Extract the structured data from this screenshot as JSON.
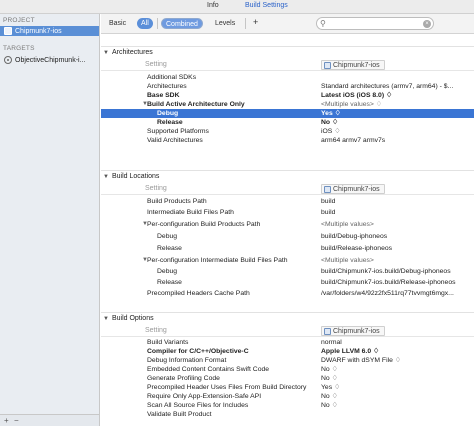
{
  "topbar": {
    "tab_info": "Info",
    "tab_build_settings": "Build Settings"
  },
  "sidebar": {
    "project_header": "PROJECT",
    "project_item": "Chipmunk7-ios",
    "targets_header": "TARGETS",
    "target_item": "ObjectiveChipmunk-i...",
    "add_label": "+",
    "remove_label": "−"
  },
  "filterbar": {
    "basic": "Basic",
    "all": "All",
    "combined": "Combined",
    "levels": "Levels",
    "add": "+",
    "search_value": ""
  },
  "sections": {
    "architectures": {
      "title": "Architectures",
      "setting_header": "Setting",
      "target": "Chipmunk7-ios",
      "rows": [
        {
          "name": "Additional SDKs",
          "value": ""
        },
        {
          "name": "Architectures",
          "value": "Standard architectures (armv7, arm64) - $..."
        },
        {
          "name": "Base SDK",
          "value": "Latest iOS (iOS 8.0) ♢"
        },
        {
          "name": "Build Active Architecture Only",
          "value": "<Multiple values> ♢"
        },
        {
          "name": "Debug",
          "value": "Yes ♢"
        },
        {
          "name": "Release",
          "value": "No ♢"
        },
        {
          "name": "Supported Platforms",
          "value": "iOS ♢"
        },
        {
          "name": "Valid Architectures",
          "value": "arm64 armv7 armv7s"
        }
      ]
    },
    "build_locations": {
      "title": "Build Locations",
      "setting_header": "Setting",
      "target": "Chipmunk7-ios",
      "rows": [
        {
          "name": "Build Products Path",
          "value": "build"
        },
        {
          "name": "Intermediate Build Files Path",
          "value": "build"
        },
        {
          "name": "Per-configuration Build Products Path",
          "value": "<Multiple values>"
        },
        {
          "name": "Debug",
          "value": "build/Debug-iphoneos"
        },
        {
          "name": "Release",
          "value": "build/Release-iphoneos"
        },
        {
          "name": "Per-configuration Intermediate Build Files Path",
          "value": "<Multiple values>"
        },
        {
          "name": "Debug",
          "value": "build/Chipmunk7-ios.build/Debug-iphoneos"
        },
        {
          "name": "Release",
          "value": "build/Chipmunk7-ios.build/Release-iphoneos"
        },
        {
          "name": "Precompiled Headers Cache Path",
          "value": "/var/folders/w4/92z2fx511rq77tvvmgt6mgx..."
        }
      ]
    },
    "build_options": {
      "title": "Build Options",
      "setting_header": "Setting",
      "target": "Chipmunk7-ios",
      "rows": [
        {
          "name": "Build Variants",
          "value": "normal"
        },
        {
          "name": "Compiler for C/C++/Objective-C",
          "value": "Apple LLVM 6.0 ♢"
        },
        {
          "name": "Debug Information Format",
          "value": "DWARF with dSYM File ♢"
        },
        {
          "name": "Embedded Content Contains Swift Code",
          "value": "No ♢"
        },
        {
          "name": "Generate Profiling Code",
          "value": "No ♢"
        },
        {
          "name": "Precompiled Header Uses Files From Build Directory",
          "value": "Yes ♢"
        },
        {
          "name": "Require Only App-Extension-Safe API",
          "value": "No ♢"
        },
        {
          "name": "Scan All Source Files for Includes",
          "value": "No ♢"
        },
        {
          "name": "Validate Built Product",
          "value": ""
        }
      ]
    }
  }
}
